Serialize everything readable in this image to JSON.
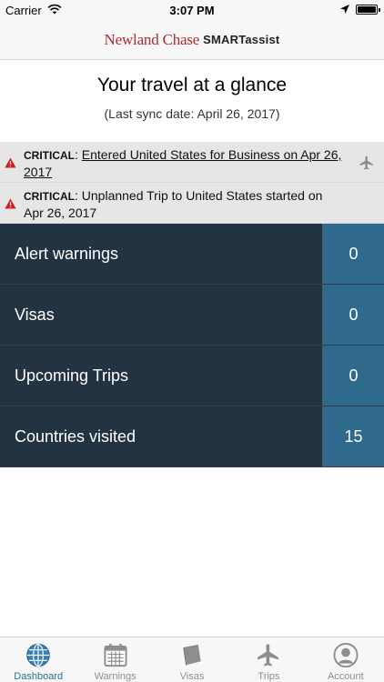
{
  "status_bar": {
    "carrier": "Carrier",
    "time": "3:07 PM"
  },
  "header": {
    "logo_primary": "Newland Chase",
    "logo_secondary": "SMARTassist",
    "logo_color": "#b3282d"
  },
  "main": {
    "title": "Your travel at a glance",
    "sync_date": "(Last sync date: April 26, 2017)"
  },
  "alerts": [
    {
      "severity": "CRITICAL",
      "separator": ": ",
      "message": "Entered United States for Business on Apr 26, 2017",
      "linked": true,
      "icon": "airplane-icon"
    },
    {
      "severity": "CRITICAL",
      "separator": ": ",
      "message": "Unplanned Trip to United States  started on Apr 26, 2017",
      "linked": false,
      "icon": ""
    }
  ],
  "summary": [
    {
      "label": "Alert warnings",
      "count": "0"
    },
    {
      "label": "Visas",
      "count": "0"
    },
    {
      "label": "Upcoming Trips",
      "count": "0"
    },
    {
      "label": "Countries visited",
      "count": "15"
    }
  ],
  "tabs": [
    {
      "label": "Dashboard",
      "icon": "globe-icon",
      "active": true
    },
    {
      "label": "Warnings",
      "icon": "calendar-icon",
      "active": false
    },
    {
      "label": "Visas",
      "icon": "passport-icon",
      "active": false
    },
    {
      "label": "Trips",
      "icon": "airplane-icon",
      "active": false
    },
    {
      "label": "Account",
      "icon": "user-icon",
      "active": false
    }
  ],
  "colors": {
    "label_bg": "#243342",
    "count_bg": "#2f6a8d",
    "active_tab": "#2b6d96",
    "warning_red": "#cc2020"
  }
}
